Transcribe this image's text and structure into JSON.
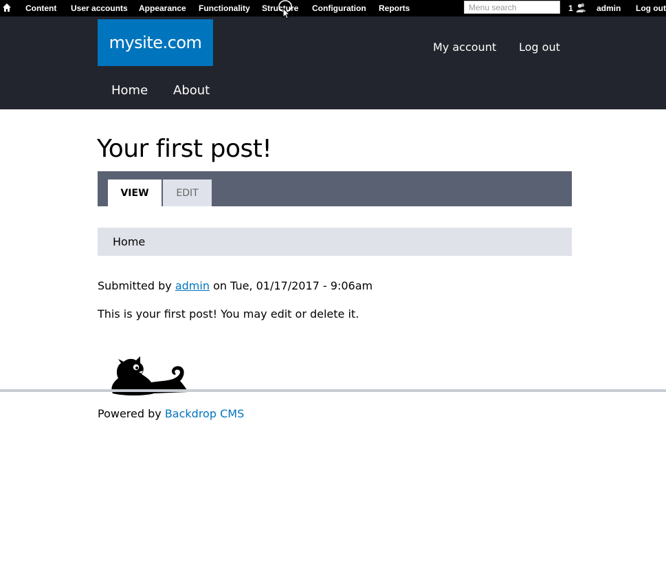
{
  "admin_bar": {
    "home_icon": "home-icon",
    "menu": [
      {
        "label": "Content"
      },
      {
        "label": "User accounts"
      },
      {
        "label": "Appearance"
      },
      {
        "label": "Functionality"
      },
      {
        "label": "Structure"
      },
      {
        "label": "Configuration"
      },
      {
        "label": "Reports"
      }
    ],
    "search_placeholder": "Menu search",
    "users_count": "1",
    "users_icon": "users-icon",
    "account": "admin",
    "logout": "Log out"
  },
  "header": {
    "site_name": "mysite.com",
    "links": {
      "my_account": "My account",
      "log_out": "Log out"
    },
    "nav": [
      {
        "label": "Home"
      },
      {
        "label": "About"
      }
    ]
  },
  "page": {
    "title": "Your first post!",
    "tabs": [
      {
        "label": "View",
        "active": true
      },
      {
        "label": "Edit",
        "active": false
      }
    ],
    "breadcrumb": "Home",
    "meta": {
      "prefix": "Submitted by",
      "author": "admin",
      "date_text": "on Tue, 01/17/2017 - 9:06am"
    },
    "body": "This is your first post! You may edit or delete it."
  },
  "footer": {
    "powered_prefix": "Powered by",
    "powered_link": "Backdrop CMS",
    "mascot_icon": "backdrop-mascot-icon"
  },
  "colors": {
    "admin_bar": "#000000",
    "header_bg": "#22252d",
    "logo_bg": "#0074bd",
    "tabs_bg": "#5a6173",
    "breadcrumb_bg": "#e0e2ea",
    "link": "#0074bd"
  }
}
